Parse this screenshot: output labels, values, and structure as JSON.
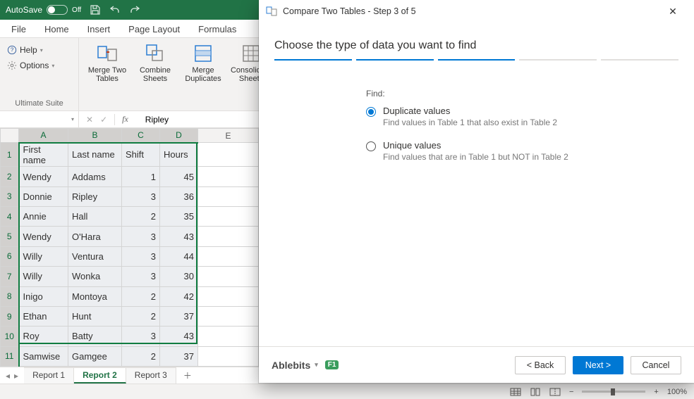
{
  "titlebar": {
    "autosave_label": "AutoSave",
    "autosave_state": "Off"
  },
  "tabs": {
    "file": "File",
    "home": "Home",
    "insert": "Insert",
    "page_layout": "Page Layout",
    "formulas": "Formulas"
  },
  "ribbon": {
    "help": "Help",
    "options": "Options",
    "group_label": "Ultimate Suite",
    "btn_merge_two": "Merge Two Tables",
    "btn_combine": "Combine Sheets",
    "btn_merge_dup": "Merge Duplicates",
    "btn_consolidate": "Consolidate Sheets"
  },
  "fbar": {
    "namebox": "",
    "fx": "fx",
    "value": "Ripley"
  },
  "cols": {
    "A": "A",
    "B": "B",
    "C": "C",
    "D": "D",
    "E": "E"
  },
  "headers": {
    "first": "First name",
    "last": "Last name",
    "shift": "Shift",
    "hours": "Hours"
  },
  "rows": [
    {
      "n": "1"
    },
    {
      "n": "2",
      "first": "Wendy",
      "last": "Addams",
      "shift": "1",
      "hours": "45"
    },
    {
      "n": "3",
      "first": "Donnie",
      "last": "Ripley",
      "shift": "3",
      "hours": "36"
    },
    {
      "n": "4",
      "first": "Annie",
      "last": "Hall",
      "shift": "2",
      "hours": "35"
    },
    {
      "n": "5",
      "first": "Wendy",
      "last": "O'Hara",
      "shift": "3",
      "hours": "43"
    },
    {
      "n": "6",
      "first": "Willy",
      "last": "Ventura",
      "shift": "3",
      "hours": "44"
    },
    {
      "n": "7",
      "first": "Willy",
      "last": "Wonka",
      "shift": "3",
      "hours": "30"
    },
    {
      "n": "8",
      "first": "Inigo",
      "last": "Montoya",
      "shift": "2",
      "hours": "42"
    },
    {
      "n": "9",
      "first": "Ethan",
      "last": "Hunt",
      "shift": "2",
      "hours": "37"
    },
    {
      "n": "10",
      "first": "Roy",
      "last": "Batty",
      "shift": "3",
      "hours": "43"
    },
    {
      "n": "11",
      "first": "Samwise",
      "last": "Gamgee",
      "shift": "2",
      "hours": "37"
    }
  ],
  "sheets": {
    "r1": "Report 1",
    "r2": "Report 2",
    "r3": "Report 3"
  },
  "status": {
    "zoom": "100%"
  },
  "dialog": {
    "title": "Compare Two Tables - Step 3 of 5",
    "heading": "Choose the type of data you want to find",
    "find_label": "Find:",
    "opt1_title": "Duplicate values",
    "opt1_sub": "Find values in Table 1 that also exist in Table 2",
    "opt2_title": "Unique values",
    "opt2_sub": "Find values that are in Table 1 but NOT in Table 2",
    "brand": "Ablebits",
    "back": "< Back",
    "next": "Next >",
    "cancel": "Cancel"
  }
}
